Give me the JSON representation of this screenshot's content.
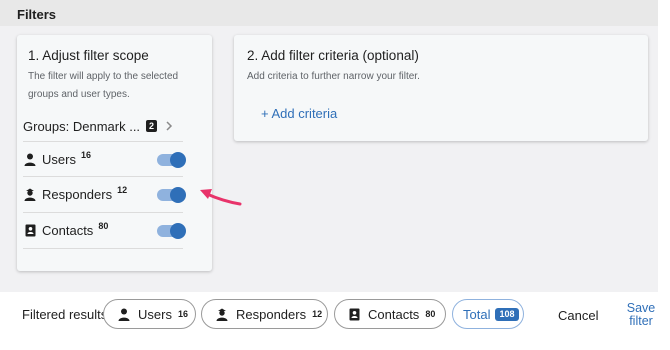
{
  "header": {
    "title": "Filters"
  },
  "scope_card": {
    "title": "1. Adjust filter scope",
    "description": "The filter will apply to the selected groups and user types.",
    "groups": {
      "label": "Groups: Denmark ...",
      "count": "2"
    },
    "rows": [
      {
        "label": "Users",
        "count": "16",
        "icon": "person-icon",
        "enabled": true
      },
      {
        "label": "Responders",
        "count": "12",
        "icon": "responder-icon",
        "enabled": true
      },
      {
        "label": "Contacts",
        "count": "80",
        "icon": "contact-card-icon",
        "enabled": true
      }
    ]
  },
  "criteria_card": {
    "title": "2. Add filter criteria (optional)",
    "description": "Add criteria to further narrow your filter.",
    "add_label": "+ Add criteria"
  },
  "footer": {
    "label": "Filtered results",
    "chips": [
      {
        "label": "Users",
        "count": "16",
        "icon": "person-icon"
      },
      {
        "label": "Responders",
        "count": "12",
        "icon": "responder-icon"
      },
      {
        "label": "Contacts",
        "count": "80",
        "icon": "contact-card-icon"
      }
    ],
    "total": {
      "label": "Total",
      "count": "108"
    },
    "cancel_label": "Cancel",
    "save_label": "Save filter"
  },
  "colors": {
    "accent": "#2f6fb8",
    "toggle_track": "#8fb2de",
    "annotation_arrow": "#e8336a"
  }
}
